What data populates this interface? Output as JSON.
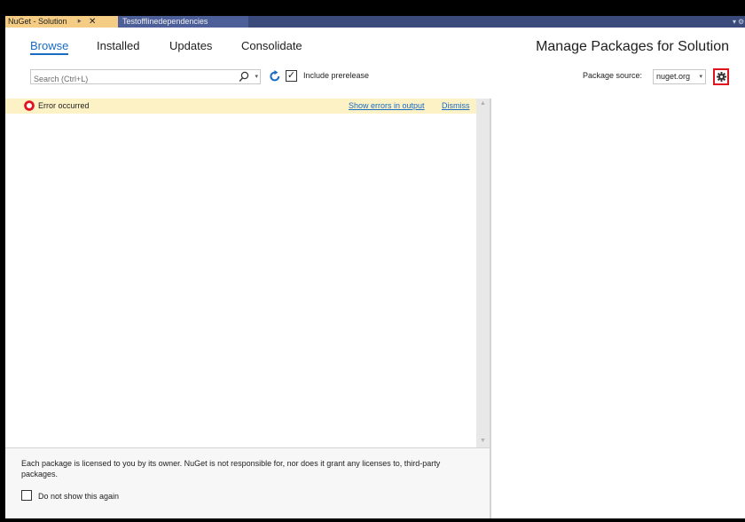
{
  "tabs": {
    "active": "NuGet - Solution",
    "inactive": "Testofflinedependencies"
  },
  "nav": {
    "browse": "Browse",
    "installed": "Installed",
    "updates": "Updates",
    "consolidate": "Consolidate"
  },
  "page_title": "Manage Packages for Solution",
  "search": {
    "placeholder": "Search (Ctrl+L)",
    "value": ""
  },
  "prerelease": {
    "label": "Include prerelease",
    "checked": true
  },
  "source": {
    "label": "Package source:",
    "value": "nuget.org"
  },
  "error": {
    "text": "Error occurred",
    "show_errors_link": "Show errors in output",
    "dismiss_link": "Dismiss"
  },
  "footer": {
    "license_text": "Each package is licensed to you by its owner. NuGet is not responsible for, nor does it grant any licenses to, third-party packages.",
    "do_not_show_label": "Do not show this again",
    "do_not_show_checked": false
  },
  "colors": {
    "accent": "#1a6bc2",
    "tab_active": "#f5cc84",
    "tabstrip": "#3a4a7a",
    "error_bar": "#fdf1c6",
    "error_icon": "#e0141e",
    "highlight": "#e0141e"
  },
  "icons": {
    "search": "search-icon",
    "refresh": "refresh-icon",
    "settings": "gear-icon",
    "error": "error-icon",
    "pin": "pin-icon",
    "close": "close-icon"
  }
}
